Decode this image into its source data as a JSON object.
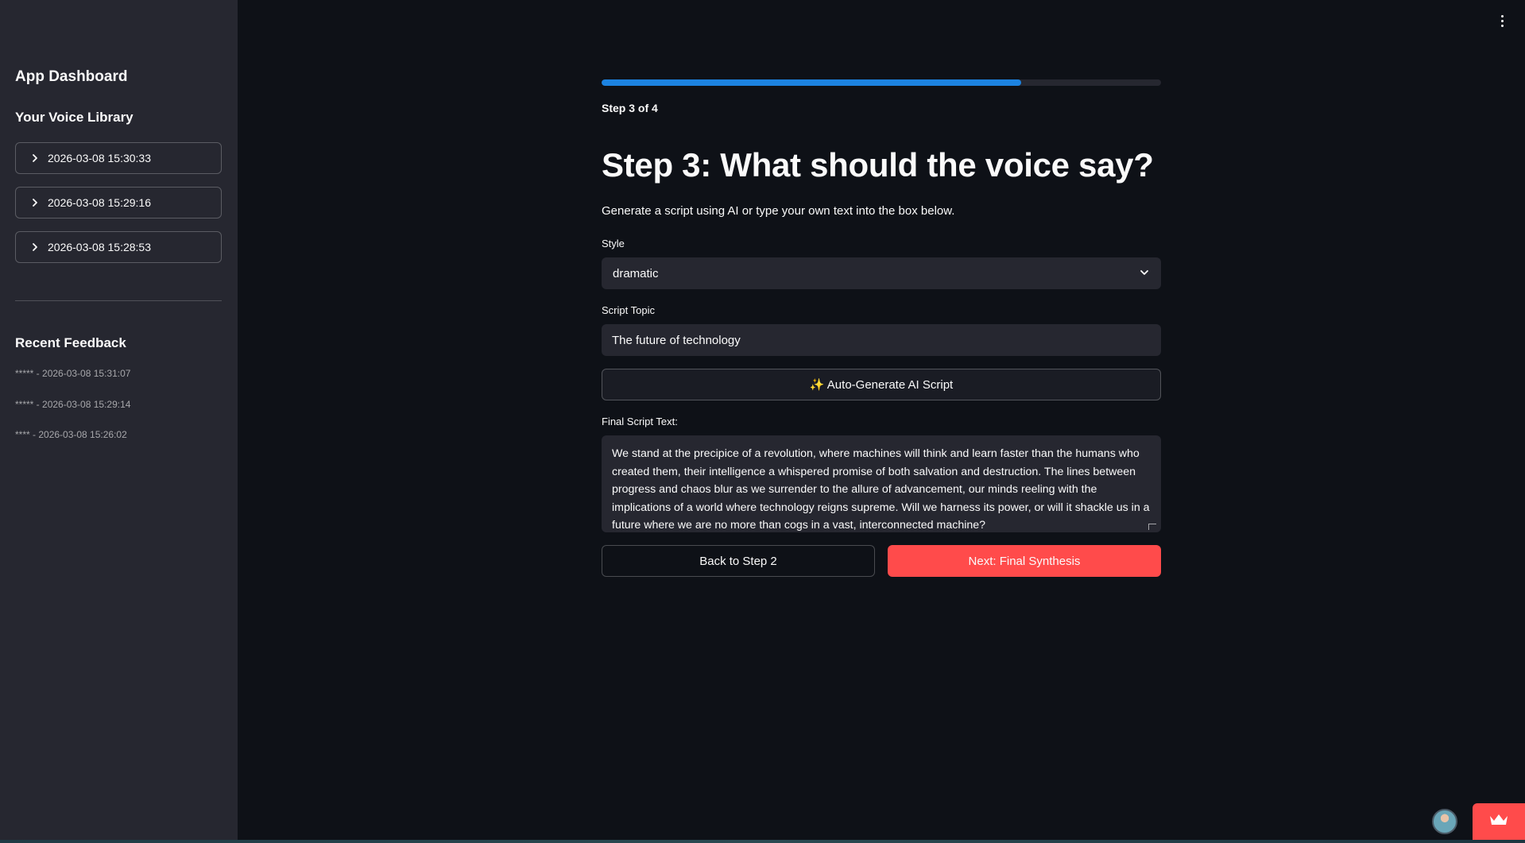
{
  "sidebar": {
    "title": "App Dashboard",
    "library_heading": "Your Voice Library",
    "library_items": [
      {
        "label": "2026-03-08 15:30:33"
      },
      {
        "label": "2026-03-08 15:29:16"
      },
      {
        "label": "2026-03-08 15:28:53"
      }
    ],
    "feedback_heading": "Recent Feedback",
    "feedback_items": [
      {
        "text": "***** - 2026-03-08 15:31:07"
      },
      {
        "text": "***** - 2026-03-08 15:29:14"
      },
      {
        "text": "**** - 2026-03-08 15:26:02"
      }
    ]
  },
  "header": {
    "menu_icon": "kebab-menu-icon"
  },
  "main": {
    "progress": {
      "fraction": 0.75,
      "color": "#1c83e1"
    },
    "step_label": "Step 3 of 4",
    "title": "Step 3: What should the voice say?",
    "subtitle": "Generate a script using AI or type your own text into the box below.",
    "style_field": {
      "label": "Style",
      "selected": "dramatic"
    },
    "topic_field": {
      "label": "Script Topic",
      "value": "The future of technology"
    },
    "generate_button": "✨ Auto-Generate AI Script",
    "script_field": {
      "label": "Final Script Text:",
      "value": "We stand at the precipice of a revolution, where machines will think and learn faster than the humans who created them, their intelligence a whispered promise of both salvation and destruction. The lines between progress and chaos blur as we surrender to the allure of advancement, our minds reeling with the implications of a world where technology reigns supreme. Will we harness its power, or will it shackle us in a future where we are no more than cogs in a vast, interconnected machine?"
    },
    "back_button": "Back to Step 2",
    "next_button": "Next: Final Synthesis"
  },
  "colors": {
    "background": "#0e1117",
    "sidebar": "#262730",
    "accent": "#ff4b4b",
    "progress": "#1c83e1"
  }
}
